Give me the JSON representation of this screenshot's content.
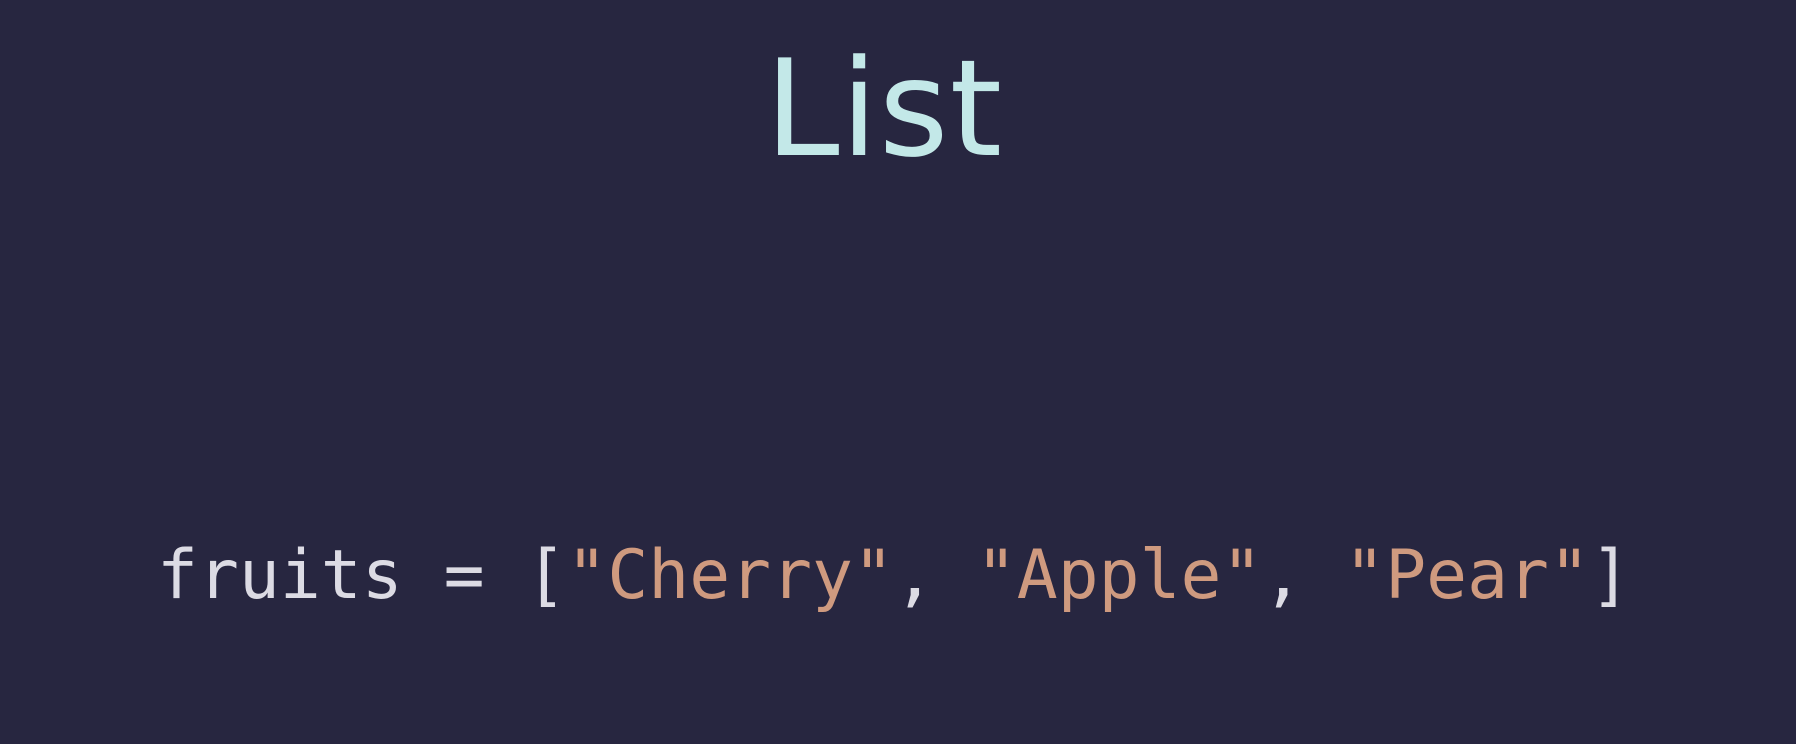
{
  "slide": {
    "title": "List"
  },
  "code": {
    "variable": "fruits",
    "assign": " = ",
    "open_bracket": "[",
    "items": [
      "\"Cherry\"",
      "\"Apple\"",
      "\"Pear\""
    ],
    "separator": ", ",
    "close_bracket": "]"
  },
  "colors": {
    "background": "#272640",
    "title": "#c3e8e8",
    "code_text": "#dcdbe4",
    "string": "#cf9a7f"
  }
}
